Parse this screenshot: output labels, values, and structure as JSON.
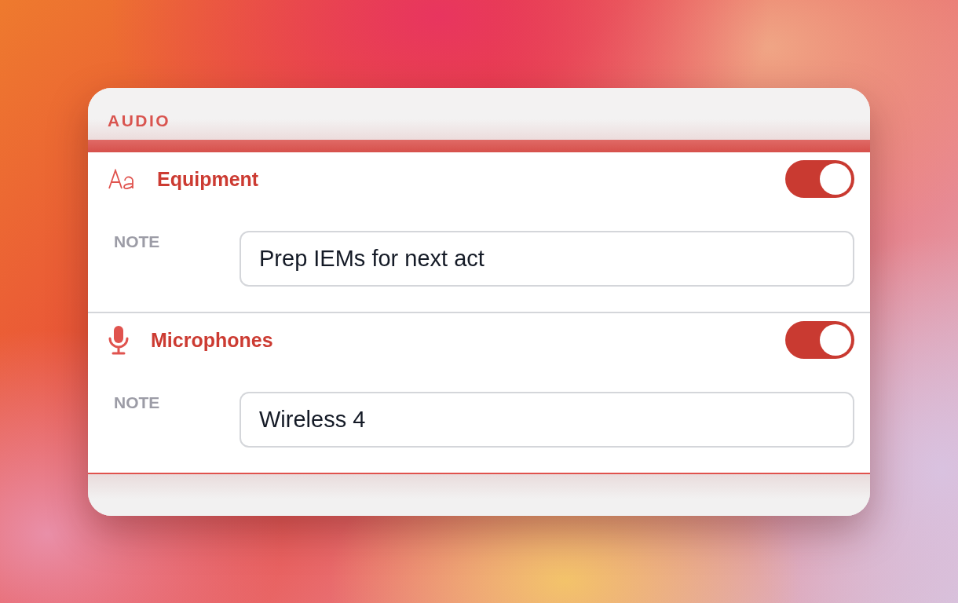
{
  "section": {
    "title": "AUDIO"
  },
  "items": [
    {
      "kind": "text",
      "label": "Equipment",
      "on": true,
      "note_label": "NOTE",
      "note": "Prep IEMs for next act"
    },
    {
      "kind": "audio",
      "label": "Microphones",
      "on": true,
      "note_label": "NOTE",
      "note": "Wireless 4"
    }
  ]
}
